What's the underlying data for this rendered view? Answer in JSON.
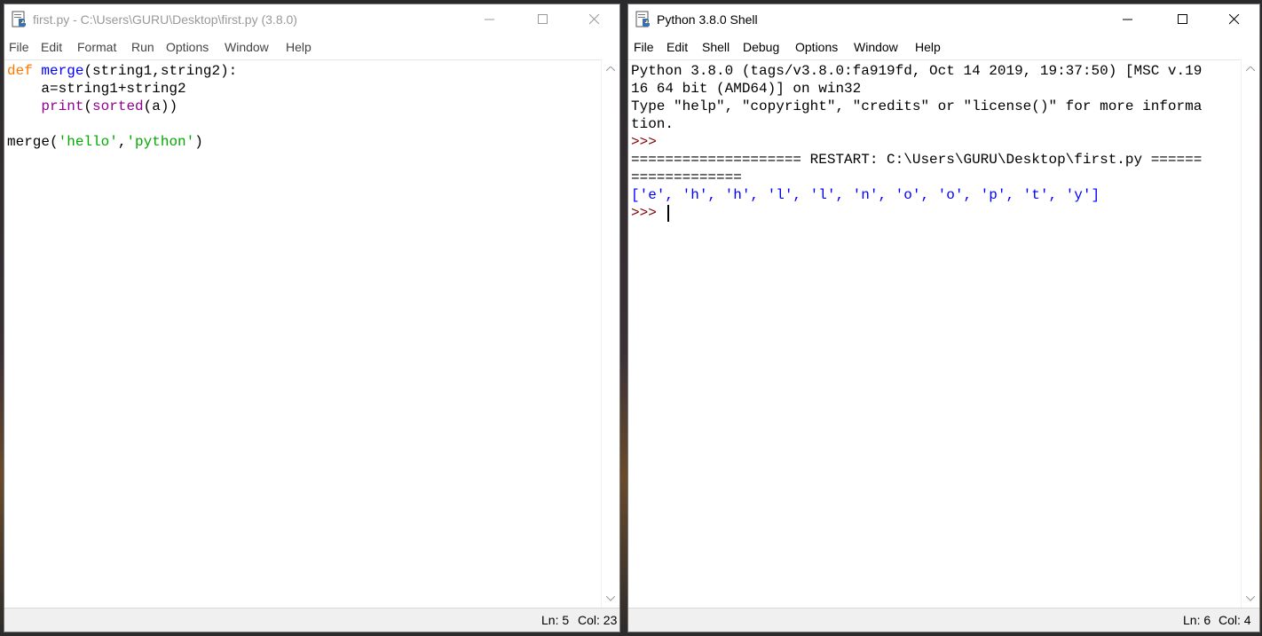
{
  "editor": {
    "title": "first.py - C:\\Users\\GURU\\Desktop\\first.py (3.8.0)",
    "menu": [
      "File",
      "Edit",
      "Format",
      "Run",
      "Options",
      "Window",
      "Help"
    ],
    "code": {
      "l1_kw": "def",
      "l1_fn": "merge",
      "l1_rest": "(string1,string2):",
      "l2": "    a=string1+string2",
      "l3_indent": "    ",
      "l3_print": "print",
      "l3_open": "(",
      "l3_sorted": "sorted",
      "l3_rest": "(a))",
      "l5_call": "merge(",
      "l5_s1": "'hello'",
      "l5_comma": ",",
      "l5_s2": "'python'",
      "l5_close": ")"
    },
    "status": {
      "ln": "Ln: 5",
      "col": "Col: 23"
    }
  },
  "shell": {
    "title": "Python 3.8.0 Shell",
    "menu": [
      "File",
      "Edit",
      "Shell",
      "Debug",
      "Options",
      "Window",
      "Help"
    ],
    "lines": {
      "banner1": "Python 3.8.0 (tags/v3.8.0:fa919fd, Oct 14 2019, 19:37:50) [MSC v.19",
      "banner2": "16 64 bit (AMD64)] on win32",
      "banner3": "Type \"help\", \"copyright\", \"credits\" or \"license()\" for more informa",
      "banner4": "tion.",
      "prompt1": ">>>",
      "restart1": "==================== RESTART: C:\\Users\\GURU\\Desktop\\first.py ======",
      "restart2": "=============",
      "output": "['e', 'h', 'h', 'l', 'l', 'n', 'o', 'o', 'p', 't', 'y']",
      "prompt2": ">>> "
    },
    "status": {
      "ln": "Ln: 6",
      "col": "Col: 4"
    }
  },
  "icons": {
    "app": "idle-python-icon",
    "minimize": "minimize-icon",
    "maximize": "maximize-icon",
    "close": "close-icon",
    "scroll_up": "chevron-up-icon",
    "scroll_down": "chevron-down-icon"
  },
  "colors": {
    "keyword": "#ff7700",
    "definition": "#0000ff",
    "builtin": "#900090",
    "string": "#00aa00",
    "prompt": "#800000",
    "stdout": "#0000ff"
  }
}
